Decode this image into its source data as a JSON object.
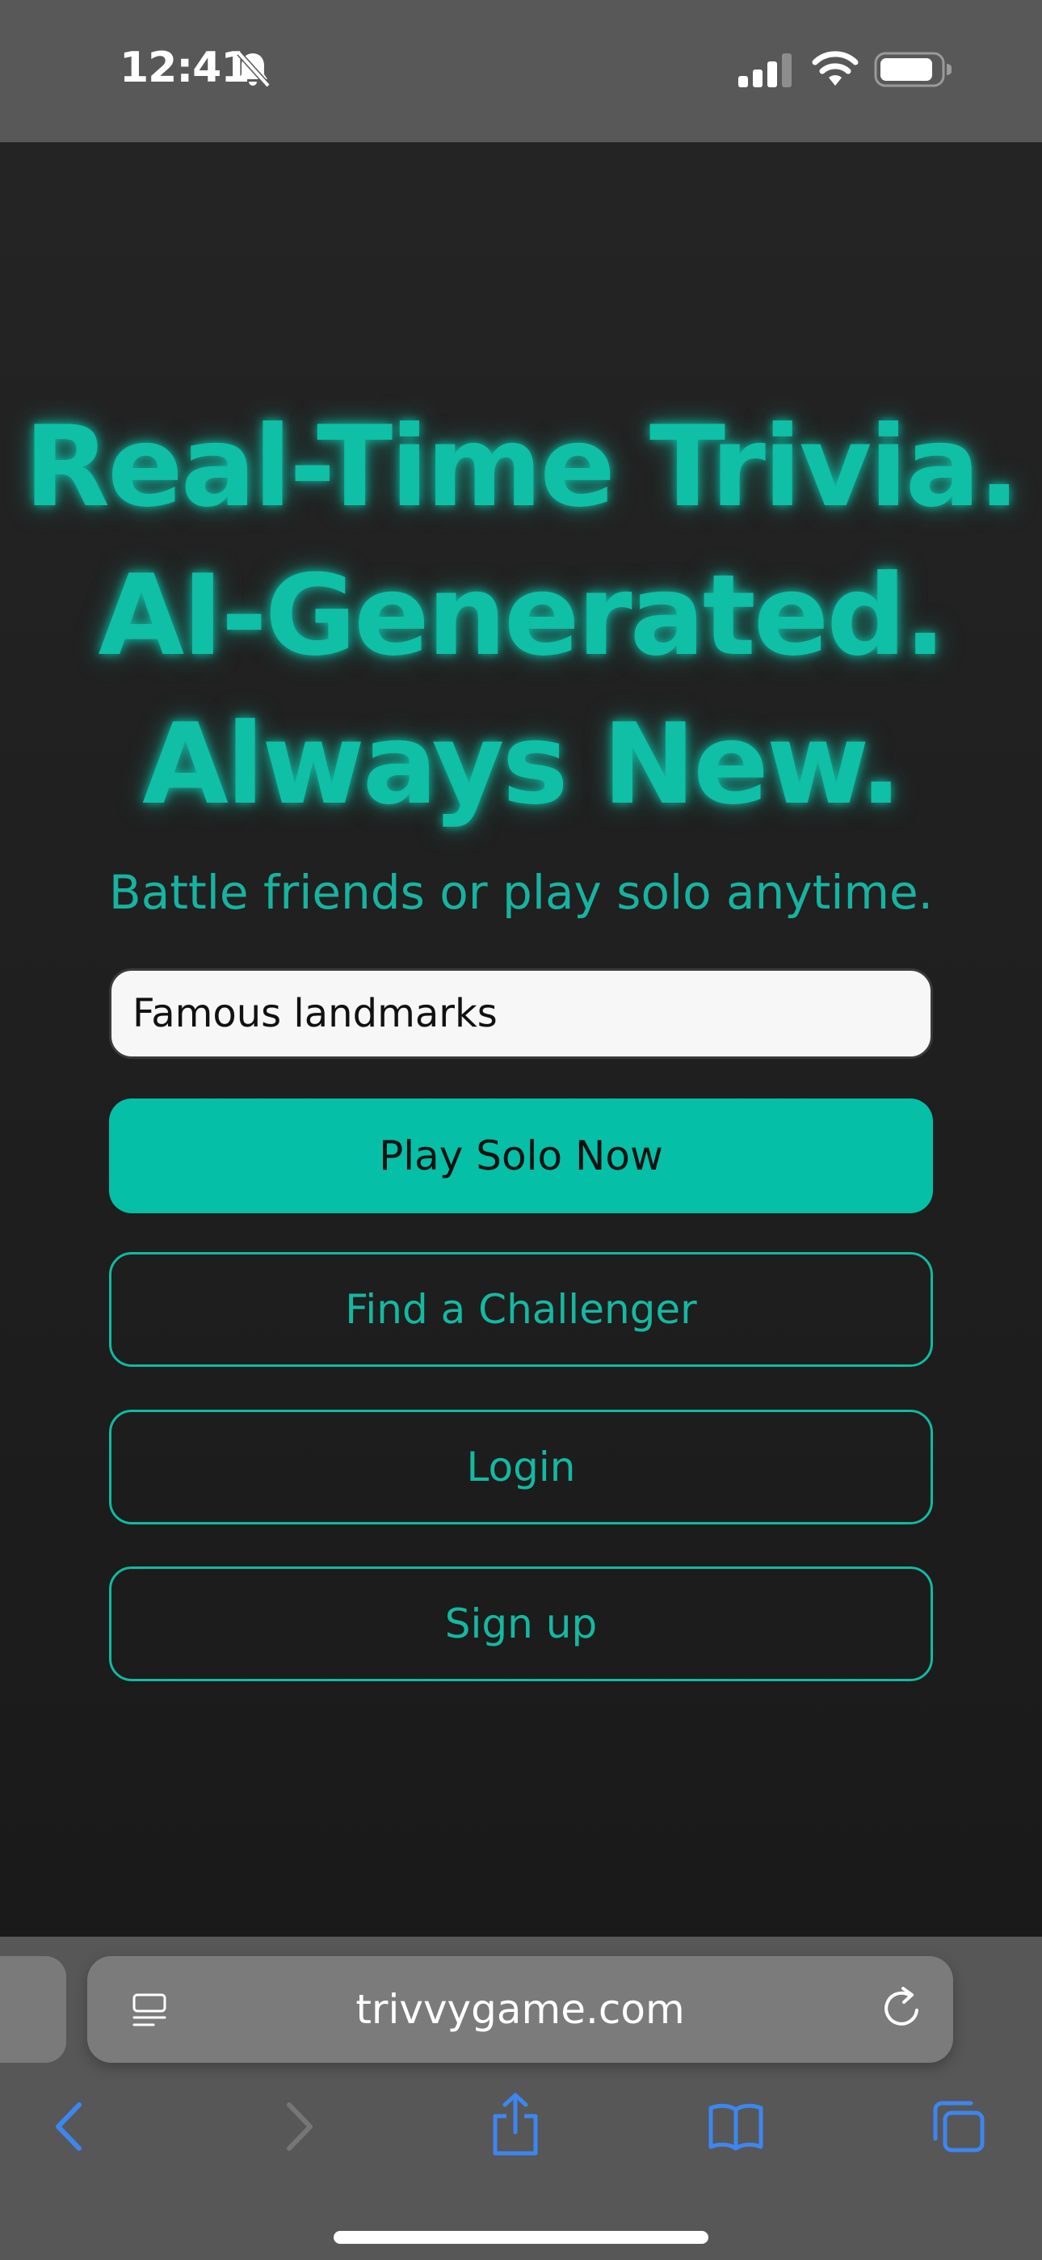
{
  "status_bar": {
    "time": "12:41",
    "icons": [
      "bell-slash-icon",
      "cellular-signal-icon",
      "wifi-icon",
      "battery-icon"
    ]
  },
  "hero": {
    "lines": [
      "Real-Time Trivia.",
      "AI-Generated.",
      "Always New."
    ],
    "tagline": "Battle friends or play solo anytime."
  },
  "form": {
    "topic_value": "Famous landmarks",
    "play_solo_label": "Play Solo Now",
    "find_challenger_label": "Find a Challenger",
    "login_label": "Login",
    "signup_label": "Sign up"
  },
  "browser": {
    "url": "trivvygame.com",
    "icons": [
      "reader-mode-icon",
      "reload-icon",
      "back-icon",
      "forward-icon",
      "share-icon",
      "bookmarks-icon",
      "tabs-icon"
    ]
  },
  "colors": {
    "accent": "#05bfa6",
    "page_background": "#1c1c1c",
    "chrome_background": "#575757",
    "toolbar_icon": "#3d86f0"
  }
}
